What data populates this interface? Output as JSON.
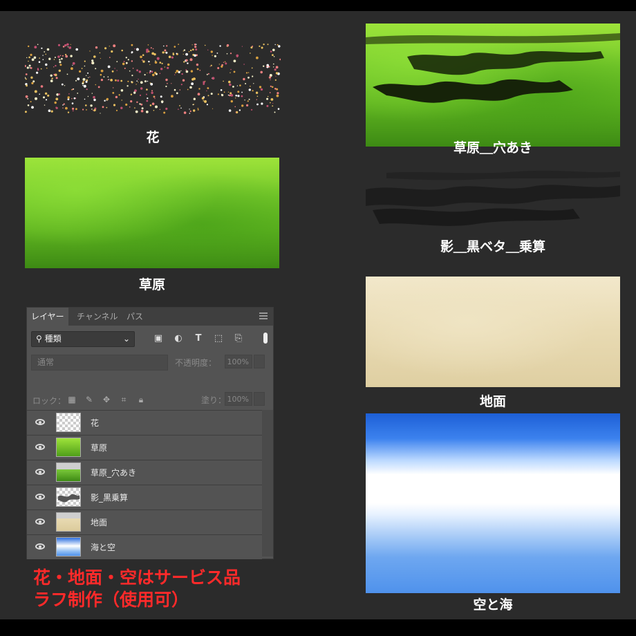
{
  "assets": {
    "flowers_caption": "花",
    "grass_holes_caption": "草原＿穴あき",
    "grass_caption": "草原",
    "shadow_caption": "影＿黒ベタ＿乗算",
    "ground_caption": "地面",
    "sky_caption": "空と海"
  },
  "panel": {
    "tabs": [
      "レイヤー",
      "チャンネル",
      "パス"
    ],
    "filter_label": "種類",
    "blend_mode": "通常",
    "opacity_label": "不透明度：",
    "opacity_value": "100%",
    "lock_label": "ロック：",
    "fill_label": "塗り：",
    "fill_value": "100%",
    "layers": [
      {
        "name": "花",
        "thumb": "transparent"
      },
      {
        "name": "草原",
        "thumb": "grass"
      },
      {
        "name": "草原_穴あき",
        "thumb": "grass-holes"
      },
      {
        "name": "影_黒乗算",
        "thumb": "shadow"
      },
      {
        "name": "地面",
        "thumb": "ground"
      },
      {
        "name": "海と空",
        "thumb": "sky"
      }
    ]
  },
  "notes": {
    "line1": "花・地面・空はサービス品",
    "line2": "ラフ制作（使用可）",
    "color": "#ff2a2a"
  }
}
